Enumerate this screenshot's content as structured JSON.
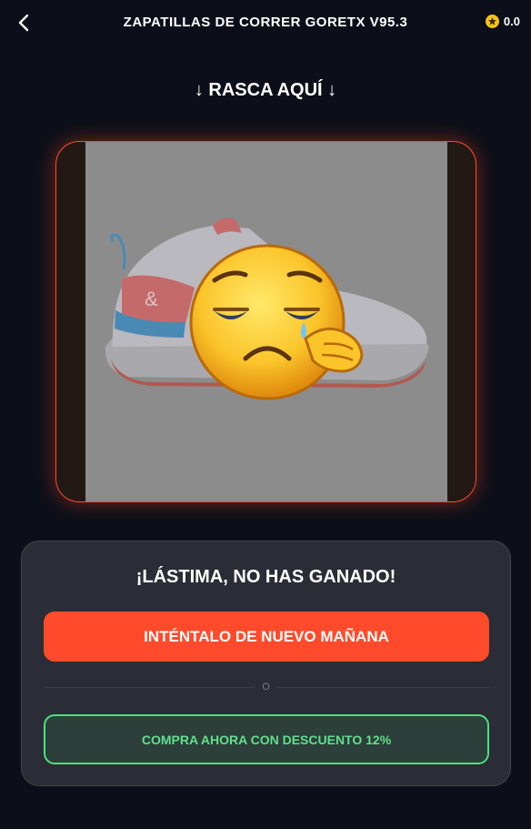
{
  "header": {
    "title": "ZAPATILLAS DE CORRER GORETX V95.3",
    "coins": "0.0"
  },
  "scratch": {
    "label": "↓ RASCA AQUÍ ↓"
  },
  "result": {
    "message": "¡LÁSTIMA, NO HAS GANADO!",
    "retry_label": "INTÉNTALO DE NUEVO MAÑANA",
    "divider_text": "O",
    "buy_label": "COMPRA AHORA CON DESCUENTO 12%"
  },
  "colors": {
    "background": "#0c0f19",
    "accent": "#ff4b2b",
    "success": "#4ee07f",
    "panel": "#2a2d35",
    "coin": "#f5c21b"
  },
  "icons": [
    "chevron-left-icon",
    "coin-star-icon",
    "crying-face-icon"
  ]
}
